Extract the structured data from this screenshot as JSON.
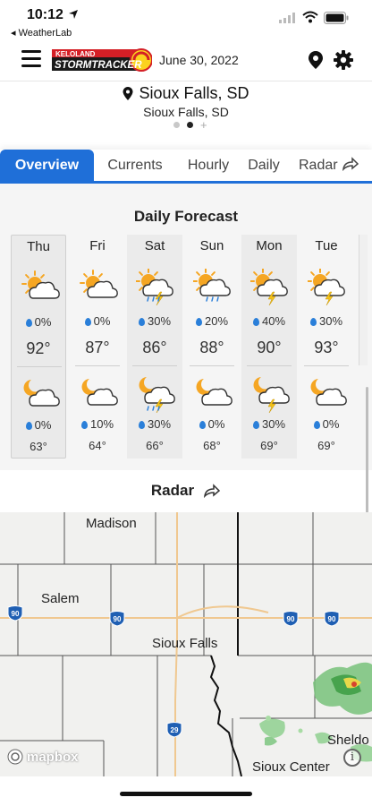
{
  "status_bar": {
    "time": "10:12",
    "back_label": "◂ WeatherLab"
  },
  "header": {
    "logo_top": "KELOLAND",
    "logo_bottom": "STORMTRACKER",
    "date": "June 30, 2022",
    "icons": [
      "menu-icon",
      "location-pin-icon",
      "gear-icon"
    ]
  },
  "location": {
    "city": "Sioux Falls, SD",
    "subtitle": "Sioux Falls, SD"
  },
  "tabs": [
    "Overview",
    "Currents",
    "Hourly",
    "Daily",
    "Radar"
  ],
  "active_tab": "Overview",
  "daily_forecast": {
    "title": "Daily Forecast",
    "days": [
      {
        "name": "Thu",
        "day_icon": "partly-sunny-icon",
        "day_precip": "0%",
        "high": "92°",
        "night_icon": "partly-cloudy-night-icon",
        "night_precip": "0%",
        "low": "63°"
      },
      {
        "name": "Fri",
        "day_icon": "partly-sunny-icon",
        "day_precip": "0%",
        "high": "87°",
        "night_icon": "partly-cloudy-night-icon",
        "night_precip": "10%",
        "low": "64°"
      },
      {
        "name": "Sat",
        "day_icon": "sun-thunderstorm-icon",
        "day_precip": "30%",
        "high": "86°",
        "night_icon": "night-thunderstorm-icon",
        "night_precip": "30%",
        "low": "66°"
      },
      {
        "name": "Sun",
        "day_icon": "sun-rain-icon",
        "day_precip": "20%",
        "high": "88°",
        "night_icon": "partly-cloudy-night-icon",
        "night_precip": "0%",
        "low": "68°"
      },
      {
        "name": "Mon",
        "day_icon": "sun-lightning-icon",
        "day_precip": "40%",
        "high": "90°",
        "night_icon": "night-lightning-icon",
        "night_precip": "30%",
        "low": "69°"
      },
      {
        "name": "Tue",
        "day_icon": "sun-lightning-icon",
        "day_precip": "30%",
        "high": "93°",
        "night_icon": "partly-cloudy-night-icon",
        "night_precip": "0%",
        "low": "69°"
      }
    ]
  },
  "radar": {
    "title": "Radar",
    "map_labels": {
      "madison": "Madison",
      "salem": "Salem",
      "sioux_falls": "Sioux Falls",
      "sheldon": "Sheldo",
      "sioux_center": "Sioux Center"
    },
    "shields": {
      "i90_a": "90",
      "i90_b": "90",
      "i90_c": "90",
      "i90_d": "90",
      "i29": "29"
    },
    "attribution": "mapbox",
    "info": "i"
  },
  "colors": {
    "accent": "#1f6fd8",
    "precip_drop": "#2a7fd9",
    "sun": "#f5a623"
  }
}
